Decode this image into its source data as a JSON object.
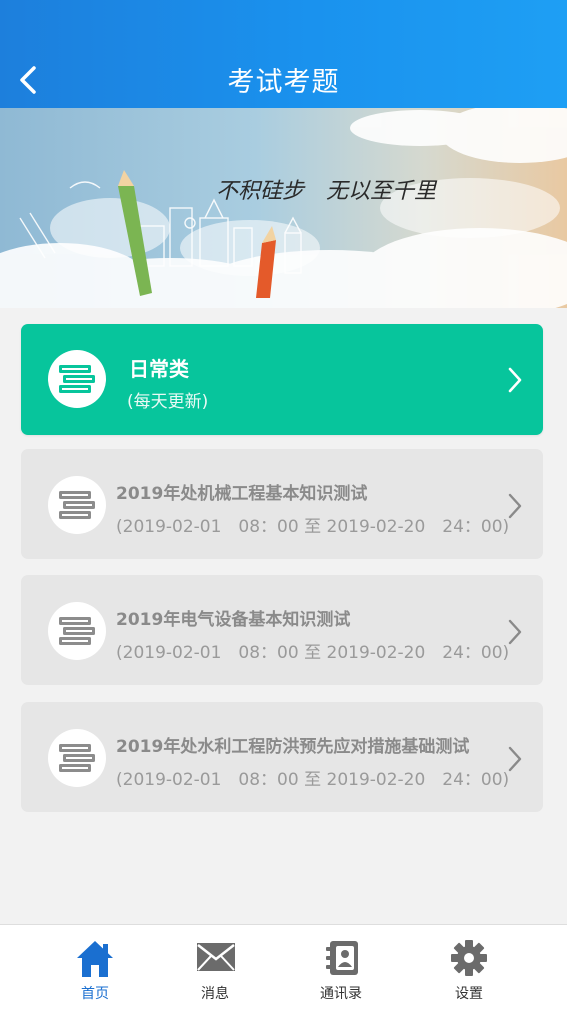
{
  "header": {
    "title": "考试考题"
  },
  "banner": {
    "slogan": "不积硅步　无以至千里"
  },
  "daily": {
    "name": "日常类",
    "subtitle": "(每天更新)"
  },
  "exams": [
    {
      "name": "2019年处机械工程基本知识测试",
      "time": "(2019-02-01　08：00 至 2019-02-20　24：00)"
    },
    {
      "name": "2019年电气设备基本知识测试",
      "time": "(2019-02-01　08：00 至 2019-02-20　24：00)"
    },
    {
      "name": "2019年处水利工程防洪预先应对措施基础测试",
      "time": "(2019-02-01　08：00 至 2019-02-20　24：00)"
    }
  ],
  "tabs": [
    {
      "label": "首页",
      "icon": "home-icon",
      "active": true
    },
    {
      "label": "消息",
      "icon": "envelope-icon"
    },
    {
      "label": "通讯录",
      "icon": "contacts-book-icon"
    },
    {
      "label": "设置",
      "icon": "gear-icon"
    }
  ],
  "colors": {
    "header": "#1a92ee",
    "accent": "#07c59c",
    "active_tab": "#1a6fd0"
  }
}
